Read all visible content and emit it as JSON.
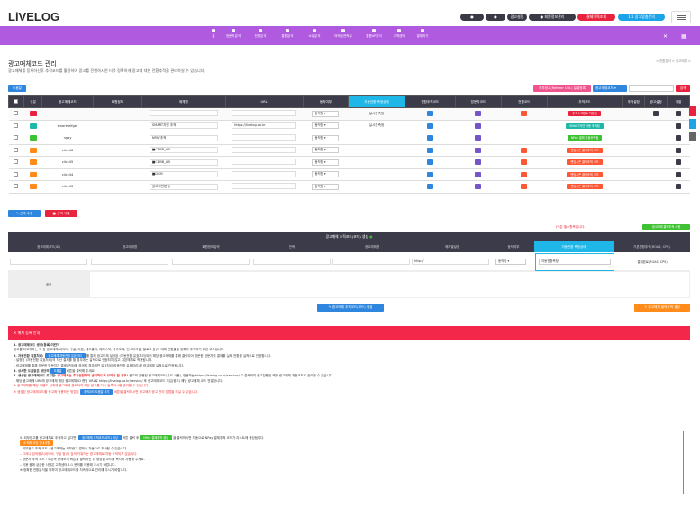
{
  "header": {
    "logo": "LiVELOG",
    "top_buttons": [
      {
        "label": "",
        "color": "#3a3a46"
      },
      {
        "label": "",
        "color": "#3a3a46"
      },
      {
        "label": "광고설정",
        "color": "#3a3a46"
      },
      {
        "label": "회원정보관리",
        "color": "#3a3a46"
      },
      {
        "label": "결제이력조회",
        "color": "#e8233e"
      },
      {
        "label": "1:1 광고맞춤문의",
        "color": "#1ca3e8"
      }
    ]
  },
  "nav": {
    "items": [
      "홈",
      "방문자분석",
      "전환분석",
      "통합분석",
      "소셜분석",
      "마케팅전략실",
      "통합UP분석",
      "고객센터",
      "결제하기"
    ]
  },
  "page": {
    "title": "광고매체코드 관리",
    "desc": "광고매체를 등록하신후 추적코드를 활용하여 광고를 진행하시면 더욱 정확하게 광고에 대한 전환추적을 관리하실 수 있습니다.",
    "breadcrumb": "< 전환분석 > 광고매체 >"
  },
  "toolbar": {
    "left_btn": "도움말",
    "right_btn1": "외부광고(Referer URL) 일괄등록",
    "select": "광고매체코드",
    "search": "검색"
  },
  "table": {
    "headers": [
      "",
      "구분",
      "광고매체코드",
      "회원정보",
      "매체명",
      "URL",
      "동작여부",
      "자동전환\n측정상태",
      "전환추적코드",
      "방문자코드",
      "전환코드",
      "추적코드",
      "추적설정",
      "광고설정",
      "개발"
    ],
    "rows": [
      {
        "type": "red",
        "code": "",
        "member": "",
        "media": "",
        "url": "",
        "status": "동작함",
        "conv": "실시간측정",
        "track": "추적스크립트 적용됨",
        "tcolor": "#e8233e",
        "sel": true
      },
      {
        "type": "teal",
        "code": "smartselfget",
        "member": "",
        "media": "SMART자연 추적",
        "url": "https://livelog.co.kr",
        "status": "동작함",
        "conv": "실시간측정",
        "track": "SMART자연 자동 추적됨",
        "tcolor": "#1db8a7",
        "sel": false
      },
      {
        "type": "green",
        "code": "npay",
        "member": "",
        "media": "NPAY추적",
        "url": "",
        "status": "동작함",
        "conv": "",
        "track": "NPay 결제 자동추적됨",
        "tcolor": "#3ec233",
        "sel": false
      },
      {
        "type": "orange",
        "code": "click46",
        "member": "",
        "media": "■CBBB_AB",
        "url": "",
        "status": "동작함",
        "conv": "",
        "track": "랜딩시즌 클릭추적 코드",
        "tcolor": "#ff5733",
        "sel": false
      },
      {
        "type": "orange",
        "code": "click45",
        "member": "",
        "media": "■CBBB_AB",
        "url": "",
        "status": "동작함",
        "conv": "",
        "track": "랜딩시즌 클릭추적 코드",
        "tcolor": "#ff5733",
        "sel": false
      },
      {
        "type": "orange",
        "code": "click44",
        "member": "",
        "media": "■DCM",
        "url": "",
        "status": "동작함",
        "conv": "",
        "track": "랜딩시즌 클릭추적 코드",
        "tcolor": "#ff5733",
        "sel": false
      },
      {
        "type": "orange",
        "code": "click43",
        "member": "",
        "media": "광고화면편집",
        "url": "",
        "status": "동작함",
        "conv": "",
        "track": "랜딩시즌 클릭추적 코드",
        "tcolor": "#ff5733",
        "sel": false
      }
    ],
    "btn_edit": "선택 수정",
    "btn_del": "선택 삭제"
  },
  "reg": {
    "note": "(*)은 필수항목입니다.",
    "note_btn": "광고매체 클릭추적 사용",
    "title": "광고매체 추적코드(코드) 생성",
    "headers": [
      "광고매체코드(ID)",
      "광고매체명",
      "회원정보입력",
      "전략",
      "광고매체명",
      "매체별설정",
      "동작여부",
      "자동전환 측정상태",
      "기본전환추적(ROAS, CPS)"
    ],
    "url_ph": "http://",
    "status": "동작함",
    "conv": "자동전환측정",
    "roas": "결제완료(ROAS, CPS)",
    "memo": "메모",
    "create_btn": "광고매체 추적코드(코드) 생성",
    "right_btn": "광고매체 클릭추적 생성"
  },
  "guide": {
    "bar": "✕ 매체 등록 안내",
    "p1h": "1. 광고매체코드 생성(등록)이란?",
    "p1": "광고를 하고자하는 각 종 광고매체(네이버, 구글, 다음, 네오클릭, 페이스북, 카카오톡, 인스타그램, 블로그 등)에 대해 전환율을 정확히 추적하기 위한 코드입니다.",
    "p2h": "2. 자동전환 유효처리:",
    "p2b": "광고매체 자동전환 유효처리",
    "p2": "를 통해 광고매체 설정된 (자동전환 유효처리)되어 해당 광고매체를 통해 클릭되어 방문한 방문자의 결제를 실제 전환된 실적으로 인정합니다.",
    "p2a": "– 설정된 (자동전환 유효처리)의 지난 결제를 할 경우에는 실적으로 인정되지 않고 기본매체로 적용됩니다.",
    "p2c": "– 광고매체를 통해 방문한 방문자가 결제(구매)를 하게될 경우에만 유효처리(자동전환 유효처리)된 광고매체 실적으로 인정됩니다.",
    "p3h": "3. 상세한 도움말은 상단의",
    "p3b": "도움말",
    "p3": "버튼을 클릭해 주세요.",
    "p4h": "4. 생성된 광고매체코드 로그인:",
    "p4r": "광고매체는 추가전환하여 관리하도록 보여야 할 경우!",
    "p4": "광고의 진행된 광고매체코드(유료 사용), 방문하는 https://livelog.co.kr/service/ 로 접속하여 광고진행된 해당 광고매체 개정코드로 관리할 수 있습니다.",
    "p4a": "– 해당 광고매체 URL에 광고매체 해당 광고매체 ID 랜딩 URL로 https://livelog.co.kr/service/ 후 광고매체코드 기입(광고) 해당 광고매체 코드 연결합니다.",
    "p4b": "※ 광고매체를 해당 이벤트 단계에 광고매체 클릭하여 해당 광고를 다시 등록하시면 관리할 수 있습니다.",
    "p4c": "※ 생성된 광고매체코드를 광고에 적용하는 방법은",
    "p4cb": "추적코드 도움말 보기",
    "p4cr": "버튼을 클릭하시면 광고매체 광고 관리 방법을 보실 수 있습니다.",
    "b1": "5. 외부광고를 광고매체로 추적하고 싶다면!",
    "b1b1": "광고매체 추적코드(코드) 생성",
    "b1m": "버튼 클릭 후",
    "b1b2": "NPay 결제추적 생성",
    "b1e": "을 클릭하시면 자동으로 NPay 결제추적 코드가 리스트에 생성됩니다.",
    "b_tag": "※ 매체 코딩 안내사항",
    "b2": "– 외부광고 추적 코드 : 광고매체는 외부광고 결제시 자동으로 추적될 수 있습니다.",
    "b3": "– 그러나 검색광고(네이버, 구글 등)의 검색 키워드는 광고매체로 자동 추적되지 않습니다.",
    "b4": "– 방문자 추적 코드 : 오른쪽 상세보기 버튼을 클릭하신 뒤 생성된 코드를 복사해 사용해 주세요.",
    "b5": "– 이용 중에 궁금한 사항은 고객센터 1:1 문의를 이용해 주시기 바랍니다.",
    "b6": "※ 정확한 전환분석을 위하여 광고매체코드를 지속적으로 관리해 주시기 바랍니다."
  }
}
